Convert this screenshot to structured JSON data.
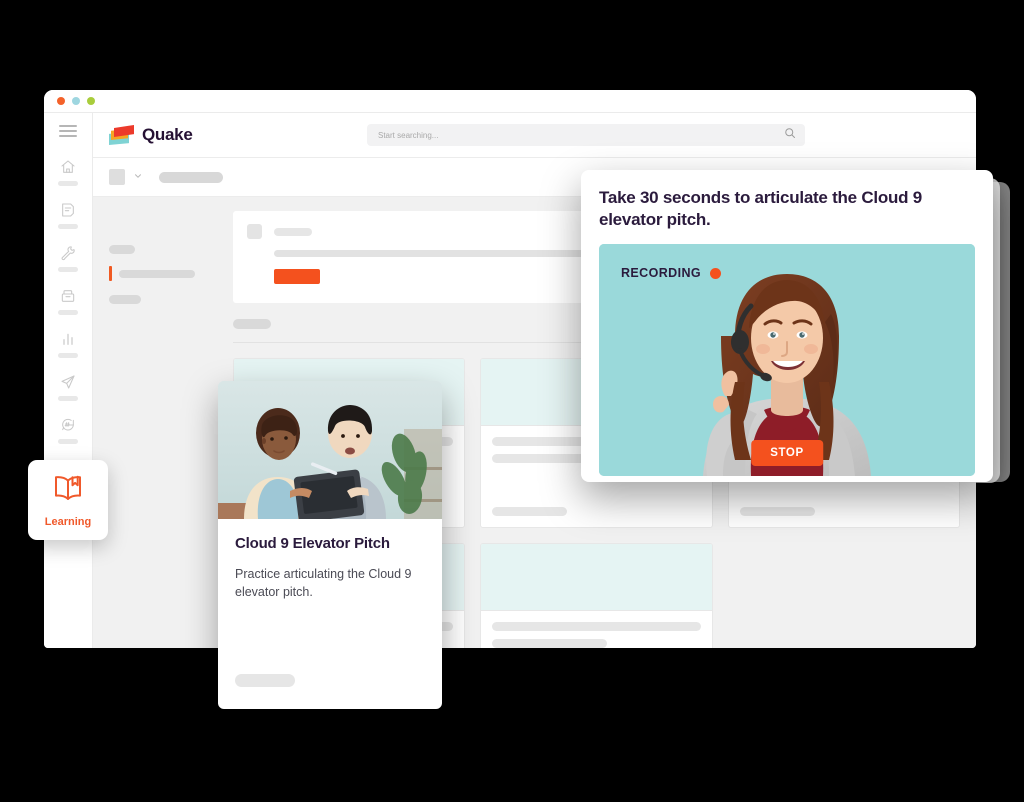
{
  "window": {
    "traffic_lights": [
      "close",
      "minimize",
      "maximize"
    ]
  },
  "brand": {
    "name": "Quake",
    "mark_colors": {
      "red": "#ec3a2b",
      "amber": "#f5a623",
      "teal": "#7fd3d4"
    },
    "wordmark_color": "#261134"
  },
  "search": {
    "placeholder": "Start searching...",
    "value": "",
    "icon": "search-icon"
  },
  "sidebar": {
    "menu_icon": "hamburger-icon",
    "items": [
      {
        "icon": "home-icon",
        "label": ""
      },
      {
        "icon": "note-icon",
        "label": ""
      },
      {
        "icon": "wrench-icon",
        "label": ""
      },
      {
        "icon": "file-box-icon",
        "label": ""
      },
      {
        "icon": "bar-chart-icon",
        "label": ""
      },
      {
        "icon": "paper-plane-icon",
        "label": ""
      },
      {
        "icon": "chat-hash-icon",
        "label": ""
      }
    ]
  },
  "learning_badge": {
    "icon": "open-book-icon",
    "label": "Learning",
    "accent": "#f0592b"
  },
  "subbar": {
    "selector_icon": "square-placeholder",
    "chevron_icon": "chevron-down-icon"
  },
  "workspace": {
    "cta_button_color": "#f4511e",
    "active_marker_color": "#f05a22",
    "card_thumb_color": "#e5f4f3",
    "cards": [
      {
        "id": "card-1"
      },
      {
        "id": "card-2"
      },
      {
        "id": "card-3"
      },
      {
        "id": "card-4"
      },
      {
        "id": "card-5"
      }
    ]
  },
  "pitch_card": {
    "title": "Cloud 9 Elevator Pitch",
    "description": "Practice articulating the Cloud 9 elevator pitch.",
    "photo_alt": "Two colleagues reviewing a tablet together"
  },
  "recording_card": {
    "title": "Take 30 seconds to articulate the Cloud 9 elevator pitch.",
    "status_label": "RECORDING",
    "status_dot_color": "#f4511e",
    "stop_button_label": "STOP",
    "video_background": "#9ad9da",
    "photo_alt": "Woman wearing a headset smiling against a teal background"
  }
}
